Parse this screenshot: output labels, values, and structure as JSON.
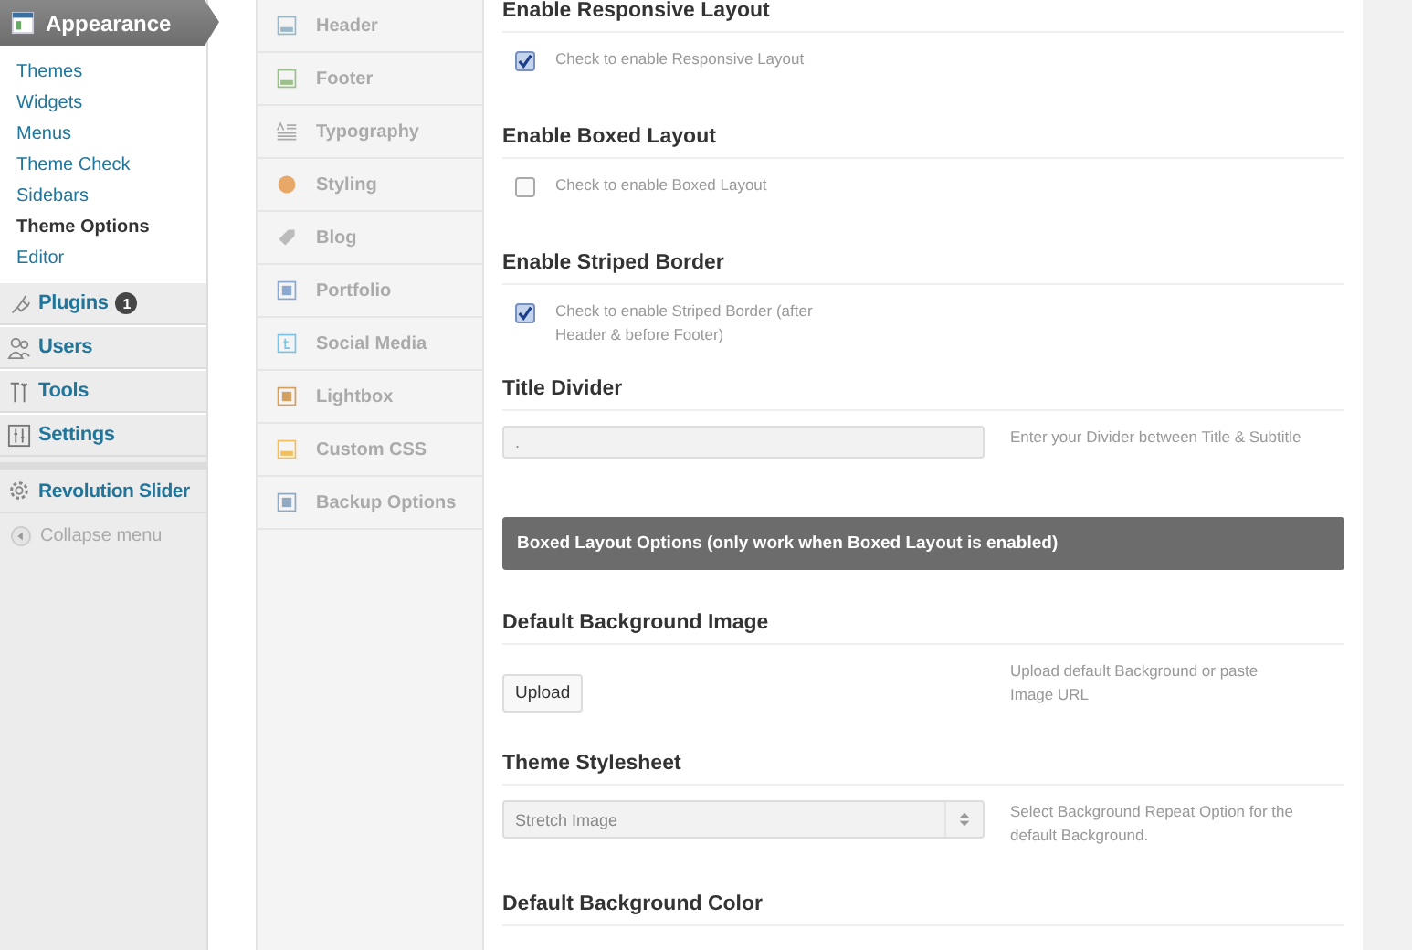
{
  "admin_menu": {
    "current": {
      "label": "Appearance",
      "submenu": [
        {
          "label": "Themes",
          "selected": false
        },
        {
          "label": "Widgets",
          "selected": false
        },
        {
          "label": "Menus",
          "selected": false
        },
        {
          "label": "Theme Check",
          "selected": false
        },
        {
          "label": "Sidebars",
          "selected": false
        },
        {
          "label": "Theme Options",
          "selected": true
        },
        {
          "label": "Editor",
          "selected": false
        }
      ]
    },
    "items": [
      {
        "label": "Plugins",
        "badge": "1"
      },
      {
        "label": "Users"
      },
      {
        "label": "Tools"
      },
      {
        "label": "Settings"
      },
      {
        "label": "Revolution Slider"
      }
    ],
    "collapse": "Collapse menu"
  },
  "options_nav": [
    {
      "label": "Header"
    },
    {
      "label": "Footer"
    },
    {
      "label": "Typography"
    },
    {
      "label": "Styling"
    },
    {
      "label": "Blog"
    },
    {
      "label": "Portfolio"
    },
    {
      "label": "Social Media"
    },
    {
      "label": "Lightbox"
    },
    {
      "label": "Custom CSS"
    },
    {
      "label": "Backup Options"
    }
  ],
  "sections": [
    {
      "kind": "checkbox",
      "title": "Enable Responsive Layout",
      "checked": true,
      "description": "Check to enable Responsive Layout"
    },
    {
      "kind": "checkbox",
      "title": "Enable Boxed Layout",
      "checked": false,
      "description": "Check to enable Boxed Layout"
    },
    {
      "kind": "checkbox",
      "title": "Enable Striped Border",
      "checked": true,
      "description": "Check to enable Striped Border (after Header & before Footer)"
    },
    {
      "kind": "text",
      "title": "Title Divider",
      "value": ".",
      "description": "Enter your Divider between Title & Subtitle"
    },
    {
      "kind": "banner",
      "title": "Boxed Layout Options (only work when Boxed Layout is enabled)"
    },
    {
      "kind": "upload",
      "title": "Default Background Image",
      "button": "Upload",
      "description": "Upload default Background or paste Image URL"
    },
    {
      "kind": "select",
      "title": "Theme Stylesheet",
      "value": "Stretch Image",
      "description": "Select Background Repeat Option for the default Background."
    },
    {
      "kind": "heading",
      "title": "Default Background Color"
    }
  ]
}
